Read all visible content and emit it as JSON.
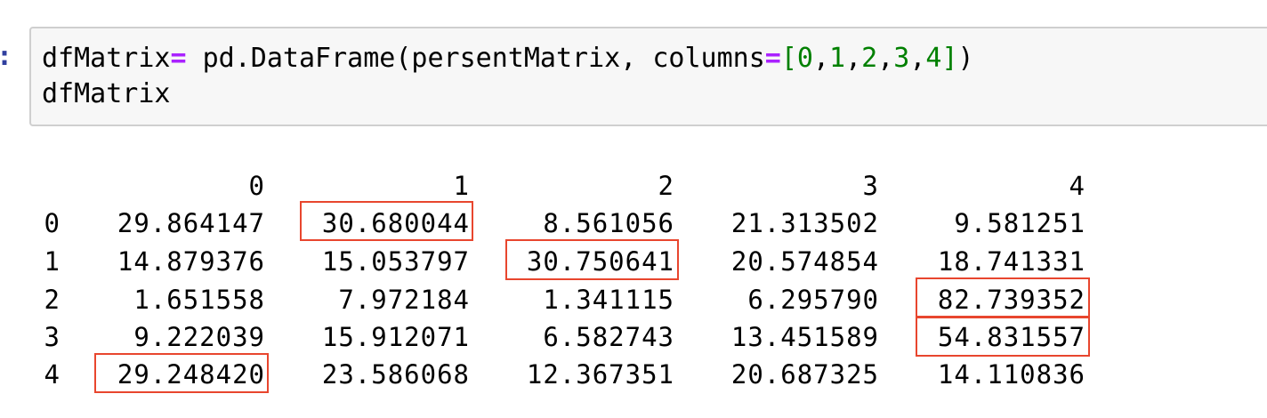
{
  "cell": {
    "prompt": ":",
    "code": {
      "line1": {
        "var": "dfMatrix",
        "eq": "=",
        "call": " pd.DataFrame(persentMatrix, columns",
        "eq2": "=",
        "open": "[",
        "n0": "0",
        "n1": "1",
        "n2": "2",
        "n3": "3",
        "n4": "4",
        "close": "]",
        "paren": ")"
      },
      "line2": "dfMatrix"
    }
  },
  "table": {
    "columns": [
      "0",
      "1",
      "2",
      "3",
      "4"
    ],
    "rows": [
      {
        "index": "0",
        "values": [
          "29.864147",
          "30.680044",
          "8.561056",
          "21.313502",
          "9.581251"
        ]
      },
      {
        "index": "1",
        "values": [
          "14.879376",
          "15.053797",
          "30.750641",
          "20.574854",
          "18.741331"
        ]
      },
      {
        "index": "2",
        "values": [
          "1.651558",
          "7.972184",
          "1.341115",
          "6.295790",
          "82.739352"
        ]
      },
      {
        "index": "3",
        "values": [
          "9.222039",
          "15.912071",
          "6.582743",
          "13.451589",
          "54.831557"
        ]
      },
      {
        "index": "4",
        "values": [
          "29.248420",
          "23.586068",
          "12.367351",
          "20.687325",
          "14.110836"
        ]
      }
    ],
    "highlight_color": "#e8462e",
    "highlighted_cells": [
      [
        0,
        1
      ],
      [
        1,
        2
      ],
      [
        2,
        4
      ],
      [
        3,
        4
      ],
      [
        4,
        0
      ]
    ]
  }
}
